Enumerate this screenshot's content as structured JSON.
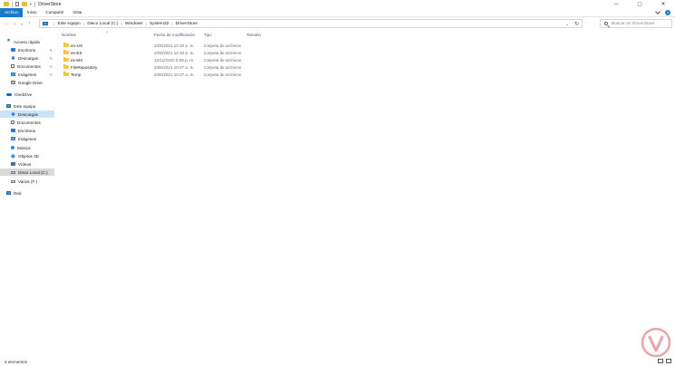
{
  "window": {
    "title": "DriverStore",
    "controls": {
      "minimize": "—",
      "maximize": "▢",
      "close": "✕"
    }
  },
  "ribbon": {
    "tabs": [
      "Archivo",
      "Inicio",
      "Compartir",
      "Vista"
    ],
    "help": "?"
  },
  "address": {
    "breadcrumbs": [
      "Este equipo",
      "Disco Local (C:)",
      "Windows",
      "System32",
      "DriverStore"
    ],
    "search_placeholder": "Buscar en DriverStore"
  },
  "navigation": {
    "quick_access": "Acceso rápido",
    "quick_items": [
      "Escritorio",
      "Descargas",
      "Documentos",
      "Imágenes",
      "Google Drive"
    ],
    "onedrive": "OneDrive",
    "this_pc": "Este equipo",
    "pc_items": [
      "Descargas",
      "Documentos",
      "Escritorio",
      "Imágenes",
      "Música",
      "Objetos 3D",
      "Vídeos",
      "Disco Local (C:)",
      "Varios (F:)"
    ],
    "network": "Red"
  },
  "columns": {
    "name": "Nombre",
    "modified": "Fecha de modificación",
    "type": "Tipo",
    "size": "Tamaño"
  },
  "files": [
    {
      "name": "en-US",
      "modified": "3/05/2021 12:40 p. m.",
      "type": "Carpeta de archivos",
      "size": ""
    },
    {
      "name": "es-ES",
      "modified": "3/05/2021 12:40 p. m.",
      "type": "Carpeta de archivos",
      "size": ""
    },
    {
      "name": "es-MX",
      "modified": "13/11/2020 5:09 p. m.",
      "type": "Carpeta de archivos",
      "size": ""
    },
    {
      "name": "FileRepository",
      "modified": "3/06/2021 10:27 a. m.",
      "type": "Carpeta de archivos",
      "size": ""
    },
    {
      "name": "Temp",
      "modified": "3/06/2021 10:27 a. m.",
      "type": "Carpeta de archivos",
      "size": ""
    }
  ],
  "status": {
    "item_count": "5 elementos"
  },
  "colors": {
    "accent": "#1979ca",
    "selection": "#cce4f7",
    "folder": "#f3c54a"
  }
}
